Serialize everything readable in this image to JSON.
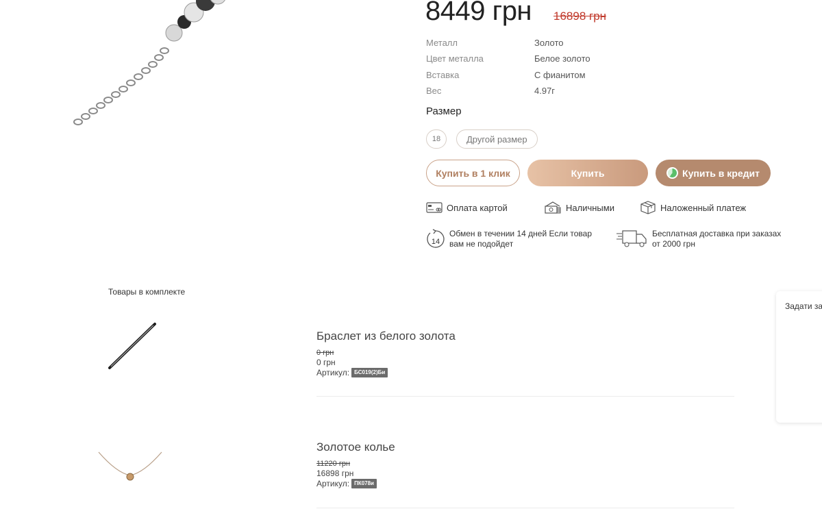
{
  "product": {
    "price_current": "8449 грн",
    "price_old": "16898 грн",
    "specs": [
      {
        "label": "Металл",
        "value": "Золото"
      },
      {
        "label": "Цвет металла",
        "value": "Белое золото"
      },
      {
        "label": "Вставка",
        "value": "С фианитом"
      },
      {
        "label": "Вес",
        "value": "4.97г"
      }
    ],
    "size_title": "Размер",
    "sizes": [
      "18",
      "Другой размер"
    ],
    "buttons": {
      "one_click": "Купить в 1 клик",
      "buy": "Купить",
      "credit": "Купить в кредит"
    },
    "payment": [
      {
        "label": "Оплата картой",
        "icon": "card-icon"
      },
      {
        "label": "Наличными",
        "icon": "cash-icon"
      },
      {
        "label": "Наложенный платеж",
        "icon": "parcel-icon"
      }
    ],
    "info": [
      {
        "label": "Обмен в течении 14 дней Если товар вам не подойдет",
        "icon": "exchange-14-days-icon"
      },
      {
        "label": "Бесплатная доставка при заказах от 2000 грн",
        "icon": "delivery-truck-icon"
      }
    ]
  },
  "kit": {
    "title": "Товары в комплекте",
    "article_label": "Артикул:",
    "items": [
      {
        "name": "Браслет из белого золота",
        "old_price": "0 грн",
        "price": "0 грн",
        "article": "БС019(2)Би"
      },
      {
        "name": "Золотое колье",
        "old_price": "11220 грн",
        "price": "16898 грн",
        "article": "ПК078и"
      }
    ]
  },
  "side_tab": {
    "label": "Задати за"
  },
  "colors": {
    "accent": "#c99a7d",
    "old_price": "#c0392b",
    "badge": "#6b6b6b"
  }
}
